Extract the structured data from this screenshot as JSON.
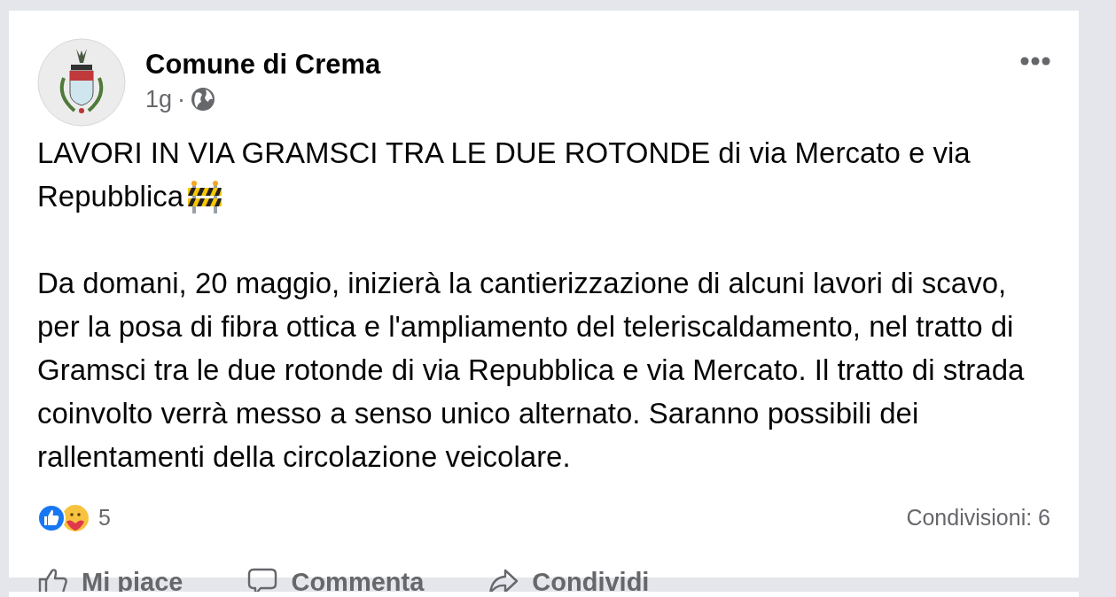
{
  "post": {
    "author": "Comune di Crema",
    "time": "1g",
    "separator": "·",
    "headline_lines": [
      "LAVORI IN VIA GRAMSCI TRA LE DUE ROTONDE di via Mercato e via",
      "Repubblica"
    ],
    "body": "Da domani, 20 maggio, inizierà la cantierizzazione di alcuni lavori di scavo, per la posa di fibra ottica e l'ampliamento del teleriscaldamento, nel tratto di Gramsci tra le due rotonde di via Repubblica e via Mercato. Il tratto di strada coinvolto verrà messo a senso unico alternato. Saranno possibili dei rallentamenti della circolazione veicolare.",
    "reaction_count": "5",
    "shares": "Condivisioni: 6",
    "actions": [
      {
        "kind": "like",
        "label": "Mi piace"
      },
      {
        "kind": "comment",
        "label": "Commenta"
      },
      {
        "kind": "share",
        "label": "Condividi"
      }
    ]
  }
}
